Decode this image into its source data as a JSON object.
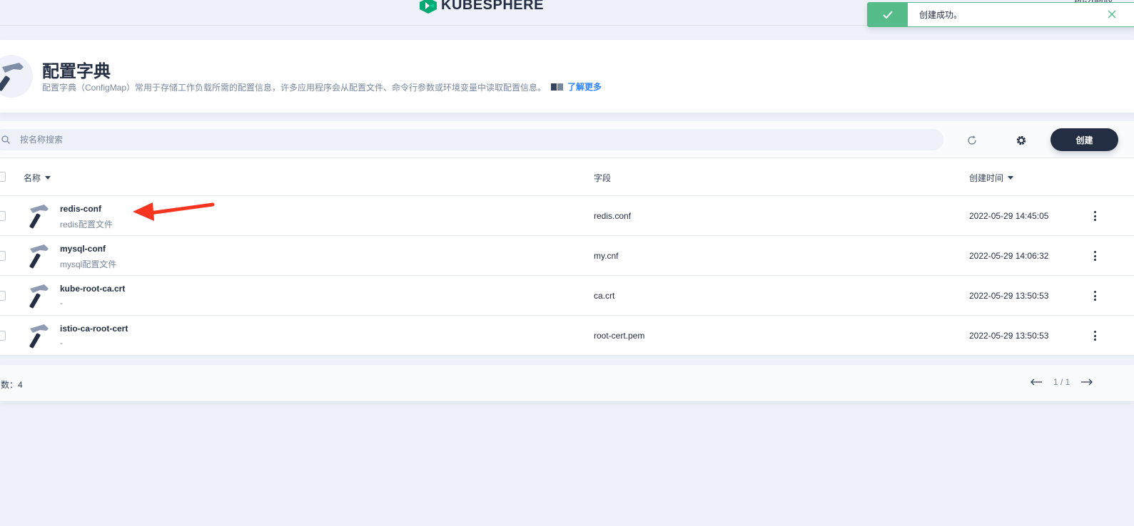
{
  "topbar": {
    "logo_text": "KUBESPHERE",
    "user_fragment": "en-zhenty"
  },
  "toast": {
    "message": "创建成功。"
  },
  "header": {
    "title": "配置字典",
    "description": "配置字典（ConfigMap）常用于存储工作负载所需的配置信息，许多应用程序会从配置文件、命令行参数或环境变量中读取配置信息。",
    "learn_more": "了解更多"
  },
  "toolbar": {
    "search_placeholder": "按名称搜索",
    "create_label": "创建"
  },
  "table": {
    "columns": {
      "name": "名称",
      "field": "字段",
      "created": "创建时间"
    },
    "rows": [
      {
        "name": "redis-conf",
        "desc": "redis配置文件",
        "field": "redis.conf",
        "time": "2022-05-29 14:45:05"
      },
      {
        "name": "mysql-conf",
        "desc": "mysql配置文件",
        "field": "my.cnf",
        "time": "2022-05-29 14:06:32"
      },
      {
        "name": "kube-root-ca.crt",
        "desc": "-",
        "field": "ca.crt",
        "time": "2022-05-29 13:50:53"
      },
      {
        "name": "istio-ca-root-cert",
        "desc": "-",
        "field": "root-cert.pem",
        "time": "2022-05-29 13:50:53"
      }
    ]
  },
  "footer": {
    "total": "数：4",
    "page": "1 / 1"
  },
  "colors": {
    "accent": "#242e42",
    "success": "#55bc8a",
    "link": "#3385ff",
    "annotation": "#f5351f"
  }
}
